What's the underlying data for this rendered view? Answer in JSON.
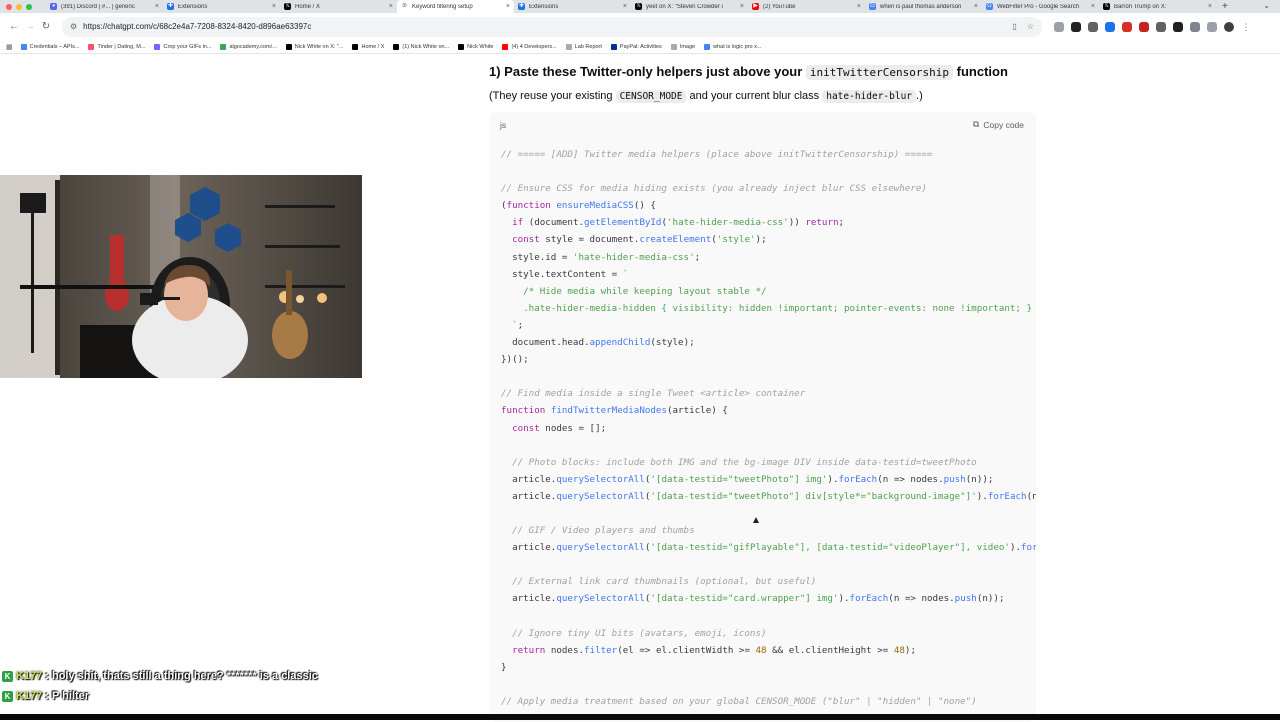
{
  "browser": {
    "tabs": [
      {
        "title": "(391) Discord | #... | generic",
        "color": "#5865f2",
        "glyph": "discord",
        "active": false
      },
      {
        "title": "Extensions",
        "color": "#1a73e8",
        "glyph": "puzzle",
        "active": false
      },
      {
        "title": "Home / X",
        "color": "#000000",
        "glyph": "x",
        "active": false
      },
      {
        "title": "Keyword filtering setup",
        "color": "#6e6e6e",
        "glyph": "chatgpt",
        "active": true
      },
      {
        "title": "Extensions",
        "color": "#1a73e8",
        "glyph": "puzzle",
        "active": false
      },
      {
        "title": "yeet on X: \"Steven Crowder i",
        "color": "#000000",
        "glyph": "x",
        "active": false
      },
      {
        "title": "(2) YouTube",
        "color": "#ff0000",
        "glyph": "youtube",
        "active": false
      },
      {
        "title": "when is paul thomas anderson",
        "color": "#4285f4",
        "glyph": "google",
        "active": false
      },
      {
        "title": "WebFilter Pro - Google Search",
        "color": "#4285f4",
        "glyph": "google",
        "active": false
      },
      {
        "title": "Barron Trump on X:",
        "color": "#000000",
        "glyph": "x",
        "active": false
      }
    ],
    "url": "https://chatgpt.com/c/68c2e4a7-7208-8324-8420-d896ae63397c",
    "bookmarks": [
      {
        "label": "Credentials – APIs...",
        "color": "#4285f4"
      },
      {
        "label": "Tinder | Dating, M...",
        "color": "#fd5068"
      },
      {
        "label": "Crop your GIFs in...",
        "color": "#7b61ff"
      },
      {
        "label": "algocademy.com/...",
        "color": "#34a853"
      },
      {
        "label": "Nick White on X: \"...",
        "color": "#000000"
      },
      {
        "label": "Home / X",
        "color": "#000000"
      },
      {
        "label": "(1) Nick White on...",
        "color": "#000000"
      },
      {
        "label": "Nick White",
        "color": "#000000"
      },
      {
        "label": "(4) 4 Developers...",
        "color": "#ff0000"
      },
      {
        "label": "Lab Report",
        "color": "#aaaaaa"
      },
      {
        "label": "PayPal: Activities",
        "color": "#003087"
      },
      {
        "label": "Image",
        "color": "#aaaaaa"
      },
      {
        "label": "what is logic pro x...",
        "color": "#4285f4"
      }
    ]
  },
  "article": {
    "heading_prefix": "1) Paste these Twitter-only helpers just above your",
    "heading_code": "initTwitterCensorship",
    "heading_suffix": "function",
    "sub_prefix": "(They reuse your existing",
    "sub_code1": "CENSOR_MODE",
    "sub_mid": "and your current blur class",
    "sub_code2": "hate-hider-blur",
    "sub_suffix": ".)"
  },
  "codeblock": {
    "language": "js",
    "copy_label": "Copy code"
  },
  "code_lines": [
    [
      {
        "t": "// ===== [ADD] Twitter media helpers (place above initTwitterCensorship) =====",
        "c": "c"
      }
    ],
    [],
    [
      {
        "t": "// Ensure CSS for media hiding exists (you already inject blur CSS elsewhere)",
        "c": "c"
      }
    ],
    [
      {
        "t": "(",
        "c": "p"
      },
      {
        "t": "function",
        "c": "k"
      },
      {
        "t": " ",
        "c": "p"
      },
      {
        "t": "ensureMediaCSS",
        "c": "f"
      },
      {
        "t": "() {",
        "c": "p"
      }
    ],
    [
      {
        "t": "  ",
        "c": "p"
      },
      {
        "t": "if",
        "c": "k"
      },
      {
        "t": " (document.",
        "c": "p"
      },
      {
        "t": "getElementById",
        "c": "f"
      },
      {
        "t": "(",
        "c": "p"
      },
      {
        "t": "'hate-hider-media-css'",
        "c": "s"
      },
      {
        "t": ")) ",
        "c": "p"
      },
      {
        "t": "return",
        "c": "k"
      },
      {
        "t": ";",
        "c": "p"
      }
    ],
    [
      {
        "t": "  ",
        "c": "p"
      },
      {
        "t": "const",
        "c": "k"
      },
      {
        "t": " style = document.",
        "c": "p"
      },
      {
        "t": "createElement",
        "c": "f"
      },
      {
        "t": "(",
        "c": "p"
      },
      {
        "t": "'style'",
        "c": "s"
      },
      {
        "t": ");",
        "c": "p"
      }
    ],
    [
      {
        "t": "  style.id = ",
        "c": "p"
      },
      {
        "t": "'hate-hider-media-css'",
        "c": "s"
      },
      {
        "t": ";",
        "c": "p"
      }
    ],
    [
      {
        "t": "  style.textContent = ",
        "c": "p"
      },
      {
        "t": "`",
        "c": "s"
      }
    ],
    [
      {
        "t": "    /* Hide media while keeping layout stable */",
        "c": "s"
      }
    ],
    [
      {
        "t": "    .hate-hider-media-hidden { visibility: hidden !important; pointer-events: none !important; }",
        "c": "s"
      }
    ],
    [
      {
        "t": "  `",
        "c": "s"
      },
      {
        "t": ";",
        "c": "p"
      }
    ],
    [
      {
        "t": "  document.head.",
        "c": "p"
      },
      {
        "t": "appendChild",
        "c": "f"
      },
      {
        "t": "(style);",
        "c": "p"
      }
    ],
    [
      {
        "t": "})();",
        "c": "p"
      }
    ],
    [],
    [
      {
        "t": "// Find media inside a single Tweet <article> container",
        "c": "c"
      }
    ],
    [
      {
        "t": "function",
        "c": "k"
      },
      {
        "t": " ",
        "c": "p"
      },
      {
        "t": "findTwitterMediaNodes",
        "c": "f"
      },
      {
        "t": "(article) {",
        "c": "p"
      }
    ],
    [
      {
        "t": "  ",
        "c": "p"
      },
      {
        "t": "const",
        "c": "k"
      },
      {
        "t": " nodes = [];",
        "c": "p"
      }
    ],
    [],
    [
      {
        "t": "  // Photo blocks: include both IMG and the bg-image DIV inside data-testid=tweetPhoto",
        "c": "c"
      }
    ],
    [
      {
        "t": "  article.",
        "c": "p"
      },
      {
        "t": "querySelectorAll",
        "c": "f"
      },
      {
        "t": "(",
        "c": "p"
      },
      {
        "t": "'[data-testid=\"tweetPhoto\"] img'",
        "c": "s"
      },
      {
        "t": ").",
        "c": "p"
      },
      {
        "t": "forEach",
        "c": "f"
      },
      {
        "t": "(n => nodes.",
        "c": "p"
      },
      {
        "t": "push",
        "c": "f"
      },
      {
        "t": "(n));",
        "c": "p"
      }
    ],
    [
      {
        "t": "  article.",
        "c": "p"
      },
      {
        "t": "querySelectorAll",
        "c": "f"
      },
      {
        "t": "(",
        "c": "p"
      },
      {
        "t": "'[data-testid=\"tweetPhoto\"] div[style*=\"background-image\"]'",
        "c": "s"
      },
      {
        "t": ").",
        "c": "p"
      },
      {
        "t": "forEach",
        "c": "f"
      },
      {
        "t": "(n => nodes.",
        "c": "p"
      },
      {
        "t": "push",
        "c": "f"
      },
      {
        "t": "(n));",
        "c": "p"
      }
    ],
    [],
    [
      {
        "t": "  // GIF / Video players and thumbs",
        "c": "c"
      }
    ],
    [
      {
        "t": "  article.",
        "c": "p"
      },
      {
        "t": "querySelectorAll",
        "c": "f"
      },
      {
        "t": "(",
        "c": "p"
      },
      {
        "t": "'[data-testid=\"gifPlayable\"], [data-testid=\"videoPlayer\"], video'",
        "c": "s"
      },
      {
        "t": ").",
        "c": "p"
      },
      {
        "t": "forEach",
        "c": "f"
      },
      {
        "t": "(n => nodes.",
        "c": "p"
      },
      {
        "t": "push",
        "c": "f"
      },
      {
        "t": "(n));",
        "c": "p"
      }
    ],
    [],
    [
      {
        "t": "  // External link card thumbnails (optional, but useful)",
        "c": "c"
      }
    ],
    [
      {
        "t": "  article.",
        "c": "p"
      },
      {
        "t": "querySelectorAll",
        "c": "f"
      },
      {
        "t": "(",
        "c": "p"
      },
      {
        "t": "'[data-testid=\"card.wrapper\"] img'",
        "c": "s"
      },
      {
        "t": ").",
        "c": "p"
      },
      {
        "t": "forEach",
        "c": "f"
      },
      {
        "t": "(n => nodes.",
        "c": "p"
      },
      {
        "t": "push",
        "c": "f"
      },
      {
        "t": "(n));",
        "c": "p"
      }
    ],
    [],
    [
      {
        "t": "  // Ignore tiny UI bits (avatars, emoji, icons)",
        "c": "c"
      }
    ],
    [
      {
        "t": "  ",
        "c": "p"
      },
      {
        "t": "return",
        "c": "k"
      },
      {
        "t": " nodes.",
        "c": "p"
      },
      {
        "t": "filter",
        "c": "f"
      },
      {
        "t": "(el => el.clientWidth >= ",
        "c": "p"
      },
      {
        "t": "48",
        "c": "n"
      },
      {
        "t": " && el.clientHeight >= ",
        "c": "p"
      },
      {
        "t": "48",
        "c": "n"
      },
      {
        "t": ");",
        "c": "p"
      }
    ],
    [
      {
        "t": "}",
        "c": "p"
      }
    ],
    [],
    [
      {
        "t": "// Apply media treatment based on your global CENSOR_MODE (\"blur\" | \"hidden\" | \"none\")",
        "c": "c"
      }
    ]
  ],
  "chat": [
    {
      "user": "K177",
      "message": "holy shit, thats still a thing here? ******* is a classic"
    },
    {
      "user": "K177",
      "message": "P hilter"
    }
  ],
  "colors": {
    "chat_user": "#d4e157",
    "chat_badge": "#2ea043",
    "code_bg": "#f9f9f9"
  }
}
